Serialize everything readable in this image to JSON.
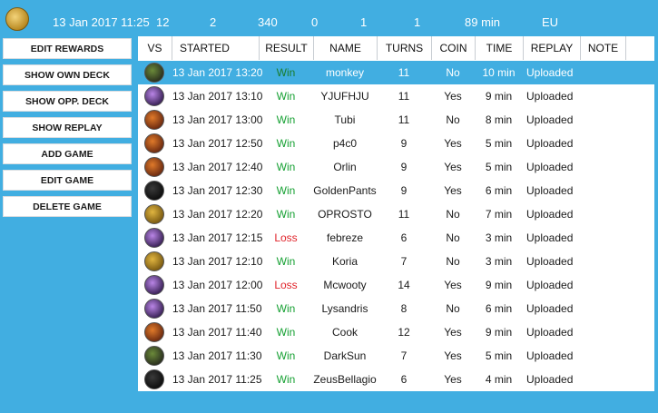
{
  "header": {
    "date": "13 Jan 2017 11:25",
    "stats": [
      "12",
      "2",
      "340",
      "0",
      "1",
      "1",
      "89 min",
      "EU"
    ]
  },
  "sidebar": {
    "buttons": [
      "EDIT REWARDS",
      "SHOW OWN DECK",
      "SHOW OPP. DECK",
      "SHOW REPLAY",
      "ADD GAME",
      "EDIT GAME",
      "DELETE GAME"
    ]
  },
  "table": {
    "columns": [
      "VS",
      "STARTED",
      "RESULT",
      "NAME",
      "TURNS",
      "COIN",
      "TIME",
      "REPLAY",
      "NOTE"
    ],
    "rows": [
      {
        "vs": "druid",
        "started": "13 Jan 2017 13:20",
        "result": "Win",
        "name": "monkey",
        "turns": "11",
        "coin": "No",
        "time": "10 min",
        "replay": "Uploaded"
      },
      {
        "vs": "priest",
        "started": "13 Jan 2017 13:10",
        "result": "Win",
        "name": "YJUFHJU",
        "turns": "11",
        "coin": "Yes",
        "time": "9 min",
        "replay": "Uploaded"
      },
      {
        "vs": "rogue",
        "started": "13 Jan 2017 13:00",
        "result": "Win",
        "name": "Tubi",
        "turns": "11",
        "coin": "No",
        "time": "8 min",
        "replay": "Uploaded"
      },
      {
        "vs": "rogue",
        "started": "13 Jan 2017 12:50",
        "result": "Win",
        "name": "p4c0",
        "turns": "9",
        "coin": "Yes",
        "time": "5 min",
        "replay": "Uploaded"
      },
      {
        "vs": "rogue",
        "started": "13 Jan 2017 12:40",
        "result": "Win",
        "name": "Orlin",
        "turns": "9",
        "coin": "Yes",
        "time": "5 min",
        "replay": "Uploaded"
      },
      {
        "vs": "hunter",
        "started": "13 Jan 2017 12:30",
        "result": "Win",
        "name": "GoldenPants",
        "turns": "9",
        "coin": "Yes",
        "time": "6 min",
        "replay": "Uploaded"
      },
      {
        "vs": "paladin",
        "started": "13 Jan 2017 12:20",
        "result": "Win",
        "name": "OPROSTO",
        "turns": "11",
        "coin": "No",
        "time": "7 min",
        "replay": "Uploaded"
      },
      {
        "vs": "priest",
        "started": "13 Jan 2017 12:15",
        "result": "Loss",
        "name": "febreze",
        "turns": "6",
        "coin": "No",
        "time": "3 min",
        "replay": "Uploaded"
      },
      {
        "vs": "paladin",
        "started": "13 Jan 2017 12:10",
        "result": "Win",
        "name": "Koria",
        "turns": "7",
        "coin": "No",
        "time": "3 min",
        "replay": "Uploaded"
      },
      {
        "vs": "priest",
        "started": "13 Jan 2017 12:00",
        "result": "Loss",
        "name": "Mcwooty",
        "turns": "14",
        "coin": "Yes",
        "time": "9 min",
        "replay": "Uploaded"
      },
      {
        "vs": "priest",
        "started": "13 Jan 2017 11:50",
        "result": "Win",
        "name": "Lysandris",
        "turns": "8",
        "coin": "No",
        "time": "6 min",
        "replay": "Uploaded"
      },
      {
        "vs": "rogue",
        "started": "13 Jan 2017 11:40",
        "result": "Win",
        "name": "Cook",
        "turns": "12",
        "coin": "Yes",
        "time": "9 min",
        "replay": "Uploaded"
      },
      {
        "vs": "druid",
        "started": "13 Jan 2017 11:30",
        "result": "Win",
        "name": "DarkSun",
        "turns": "7",
        "coin": "Yes",
        "time": "5 min",
        "replay": "Uploaded"
      },
      {
        "vs": "hunter",
        "started": "13 Jan 2017 11:25",
        "result": "Win",
        "name": "ZeusBellagio",
        "turns": "6",
        "coin": "Yes",
        "time": "4 min",
        "replay": "Uploaded"
      }
    ],
    "selected_row": 0
  },
  "colors": {
    "accent": "#41aee1",
    "win": "#15a032",
    "loss": "#e0232a"
  },
  "class_icon_colors": {
    "druid": [
      "#6b8a3a",
      "#2a2f1e"
    ],
    "priest": [
      "#b985e6",
      "#3a2257"
    ],
    "rogue": [
      "#e07a2a",
      "#6b2a10"
    ],
    "hunter": [
      "#3a3a3a",
      "#0d0d0d"
    ],
    "paladin": [
      "#e0b540",
      "#7a5a12"
    ]
  }
}
